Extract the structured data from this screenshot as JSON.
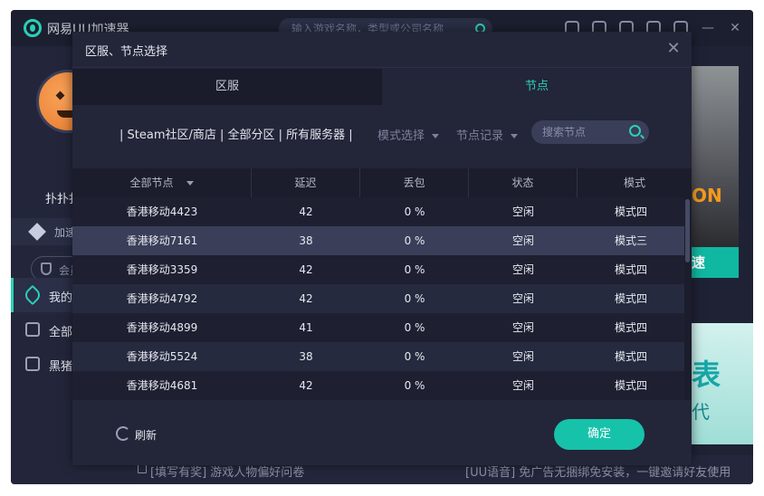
{
  "app": {
    "title": "网易UU加速器",
    "search_placeholder": "输入游戏名称，类型或公司名称",
    "user_name": "扑扑扑",
    "speed_label": "加速",
    "member_label": "会员",
    "nav": [
      {
        "label": "我的"
      },
      {
        "label": "全部"
      },
      {
        "label": "黑猪"
      }
    ],
    "banner1_text": "ON",
    "banner1_button": "速",
    "banner2_t1": "表",
    "banner2_t2": "代",
    "bottom_left": "[填写有奖] 游戏人物偏好问卷",
    "bottom_right": "[UU语音] 免广告无捆绑免安装，一键邀请好友使用"
  },
  "modal": {
    "title": "区服、节点选择",
    "close_glyph": "✕",
    "tabs": [
      {
        "label": "区服",
        "active": false
      },
      {
        "label": "节点",
        "active": true
      }
    ],
    "filter_text": "| Steam社区/商店 | 全部分区 | 所有服务器 |",
    "mode_select": "模式选择",
    "node_history": "节点记录",
    "search_placeholder": "搜索节点",
    "columns": [
      "全部节点",
      "延迟",
      "丢包",
      "状态",
      "模式"
    ],
    "rows": [
      {
        "node": "香港移动4423",
        "latency": "42",
        "loss": "0 %",
        "status": "空闲",
        "mode": "模式四"
      },
      {
        "node": "香港移动7161",
        "latency": "38",
        "loss": "0 %",
        "status": "空闲",
        "mode": "模式三"
      },
      {
        "node": "香港移动3359",
        "latency": "42",
        "loss": "0 %",
        "status": "空闲",
        "mode": "模式四"
      },
      {
        "node": "香港移动4792",
        "latency": "42",
        "loss": "0 %",
        "status": "空闲",
        "mode": "模式四"
      },
      {
        "node": "香港移动4899",
        "latency": "41",
        "loss": "0 %",
        "status": "空闲",
        "mode": "模式四"
      },
      {
        "node": "香港移动5524",
        "latency": "38",
        "loss": "0 %",
        "status": "空闲",
        "mode": "模式四"
      },
      {
        "node": "香港移动4681",
        "latency": "42",
        "loss": "0 %",
        "status": "空闲",
        "mode": "模式四"
      }
    ],
    "selected_row": 1,
    "refresh_label": "刷新",
    "confirm_label": "确定"
  },
  "colors": {
    "accent": "#2ad0b6",
    "confirm_button": "#17c2aa",
    "modal_bg": "#232538"
  }
}
